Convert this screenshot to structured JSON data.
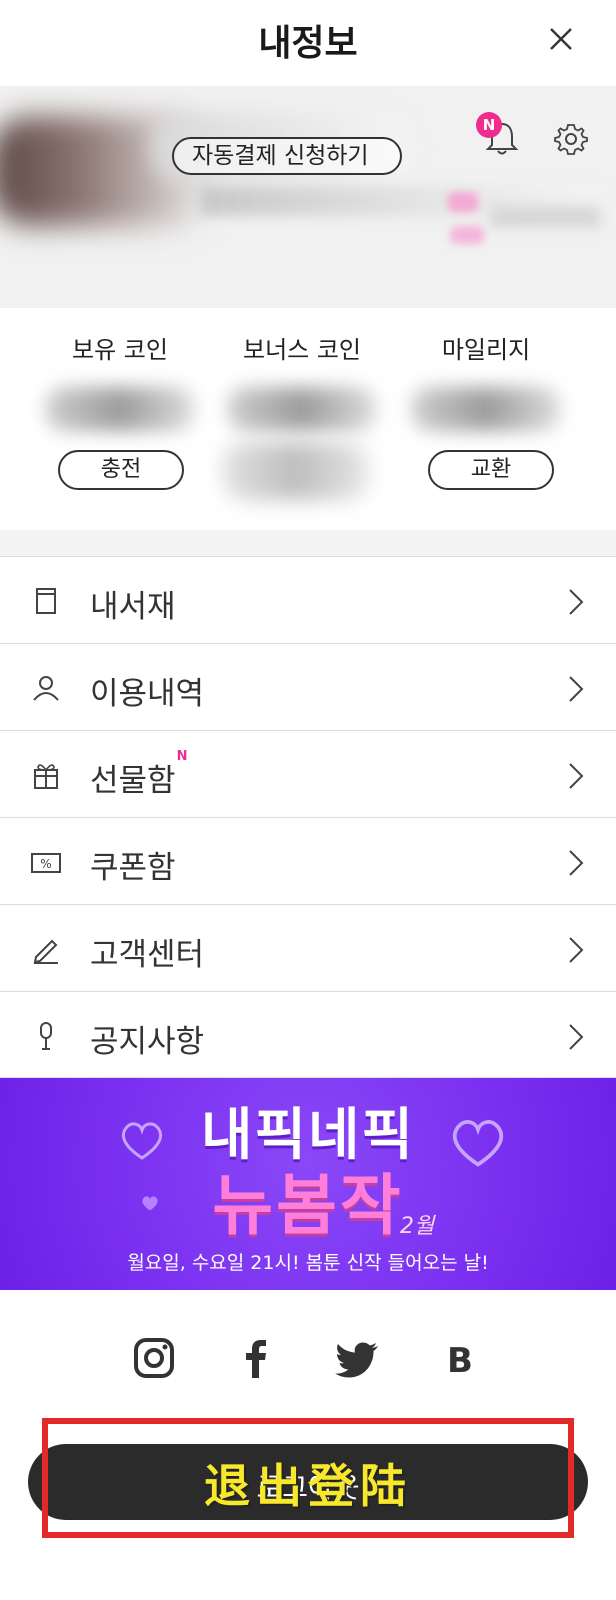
{
  "header": {
    "title": "내정보",
    "close_icon": "close-icon"
  },
  "profile": {
    "autopay_label": "자동결제 신청하기",
    "notification_badge": "N",
    "icons": [
      "bell-icon",
      "gear-icon"
    ]
  },
  "wallet": {
    "owned_coin_label": "보유 코인",
    "bonus_coin_label": "보너스 코인",
    "mileage_label": "마일리지",
    "charge_label": "충전",
    "exchange_label": "교환"
  },
  "menu": {
    "items": [
      {
        "label": "내서재",
        "icon": "book-icon"
      },
      {
        "label": "이용내역",
        "icon": "user-icon"
      },
      {
        "label": "선물함",
        "icon": "gift-icon",
        "badge": "N"
      },
      {
        "label": "쿠폰함",
        "icon": "coupon-icon"
      },
      {
        "label": "고객센터",
        "icon": "pencil-icon"
      },
      {
        "label": "공지사항",
        "icon": "microphone-icon"
      }
    ]
  },
  "promo": {
    "title_line1": "내픽네픽",
    "title_line2": "뉴봄작",
    "month": "2월",
    "subtitle": "월요일, 수요일 21시! 봄툰 신작 들어오는 날!",
    "background_color": "#7a2ff0",
    "accent_color": "#ff7fd8"
  },
  "social": {
    "icons": [
      "instagram-icon",
      "facebook-icon",
      "twitter-icon",
      "blog-icon"
    ]
  },
  "logout": {
    "label": "로그아웃",
    "annotation": "退出登陆"
  },
  "colors": {
    "badge_pink": "#ee2d8f",
    "annotation_red": "#e32a2a",
    "annotation_yellow": "#f7e82b",
    "button_dark": "#2b2b2b"
  }
}
